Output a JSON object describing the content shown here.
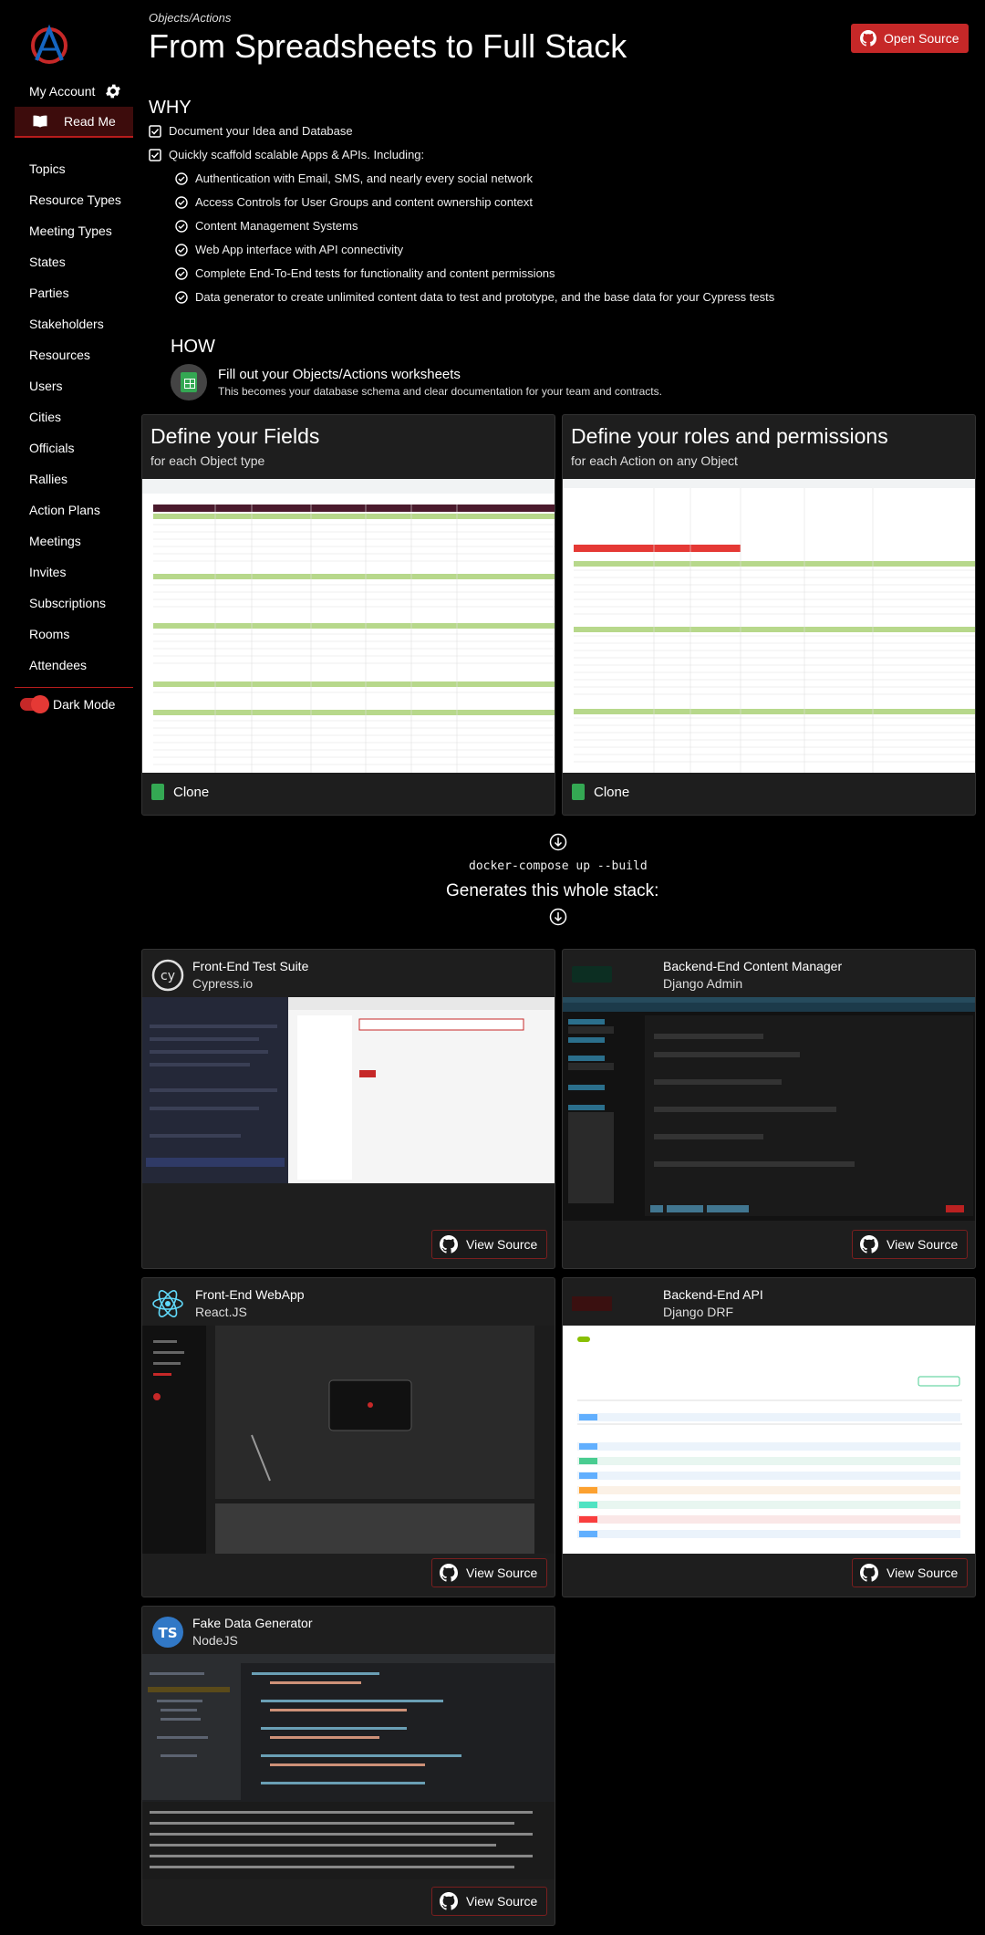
{
  "sidebar": {
    "account_label": "My Account",
    "readme_label": "Read Me",
    "items": [
      "Topics",
      "Resource Types",
      "Meeting Types",
      "States",
      "Parties",
      "Stakeholders",
      "Resources",
      "Users",
      "Cities",
      "Officials",
      "Rallies",
      "Action Plans",
      "Meetings",
      "Invites",
      "Subscriptions",
      "Rooms",
      "Attendees"
    ],
    "dark_mode_label": "Dark Mode"
  },
  "header": {
    "breadcrumb": "Objects/Actions",
    "title": "From Spreadsheets to Full Stack",
    "open_source_label": "Open Source"
  },
  "why": {
    "title": "WHY",
    "points": [
      "Document your Idea and Database",
      "Quickly scaffold scalable Apps & APIs. Including:"
    ],
    "features": [
      "Authentication with Email, SMS, and nearly every social network",
      "Access Controls for User Groups and content ownership context",
      "Content Management Systems",
      "Web App interface with API connectivity",
      "Complete End-To-End tests for functionality and content permissions",
      "Data generator to create unlimited content data to test and prototype, and the base data for your Cypress tests"
    ]
  },
  "how": {
    "title": "HOW",
    "main": "Fill out your Objects/Actions worksheets",
    "sub": "This becomes your database schema and clear documentation for your team and contracts."
  },
  "worksheets": [
    {
      "title": "Define your Fields",
      "subtitle": "for each Object type",
      "clone_label": "Clone"
    },
    {
      "title": "Define your roles and permissions",
      "subtitle": "for each Action on any Object",
      "clone_label": "Clone"
    }
  ],
  "command": "docker-compose up --build",
  "generates": "Generates this whole stack:",
  "stack": [
    {
      "title": "Front-End Test Suite",
      "subtitle": "Cypress.io",
      "button": "View Source"
    },
    {
      "title": "Backend-End Content Manager",
      "subtitle": "Django Admin",
      "button": "View Source"
    },
    {
      "title": "Front-End WebApp",
      "subtitle": "React.JS",
      "button": "View Source"
    },
    {
      "title": "Backend-End API",
      "subtitle": "Django DRF",
      "button": "View Source"
    },
    {
      "title": "Fake Data Generator",
      "subtitle": "NodeJS",
      "button": "View Source"
    }
  ],
  "logos": {
    "cypress": "cy",
    "nodejs": "TS"
  },
  "colors": {
    "accent": "#c62828",
    "green": "#34a853",
    "background": "#000000",
    "card": "#1e1e1e"
  }
}
